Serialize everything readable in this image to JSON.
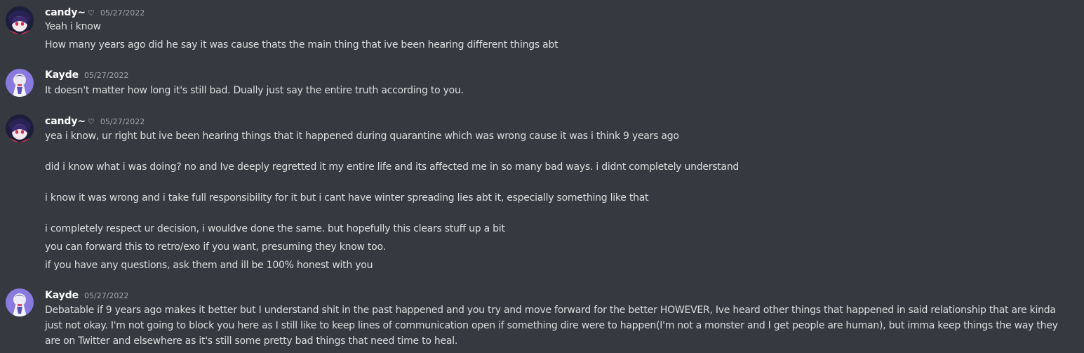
{
  "messages": [
    {
      "username": "candy~",
      "badge": "♡",
      "timestamp": "05/27/2022",
      "avatar": "candy-avatar-icon",
      "lines": [
        "Yeah i know",
        "How many years ago did he say it was cause thats the main thing that ive been hearing different things abt"
      ]
    },
    {
      "username": "Kayde",
      "timestamp": "05/27/2022",
      "avatar": "kayde-avatar-icon",
      "lines": [
        "It doesn't matter how long it's still bad. Dually just say the entire truth according to you."
      ]
    },
    {
      "username": "candy~",
      "badge": "♡",
      "timestamp": "05/27/2022",
      "avatar": "candy-avatar-icon",
      "lines": [
        "yea i know, ur right but ive been hearing things that it happened during quarantine which was wrong cause it was i think 9 years ago",
        "did i know what i was doing? no and Ive deeply regretted it my entire life and its affected me in so many bad ways. i didnt completely understand",
        "i know it was wrong and i take full responsibility for it but i cant have winter spreading lies abt it, especially something like that",
        "i completely respect ur decision, i wouldve done the same. but hopefully this clears stuff up a bit",
        "you can forward this to retro/exo if you want, presuming they know too.",
        "if you have any questions, ask them and ill be 100% honest with you"
      ]
    },
    {
      "username": "Kayde",
      "timestamp": "05/27/2022",
      "avatar": "kayde-avatar-icon",
      "lines": [
        "Debatable if 9 years ago makes it better but I understand shit in the past happened and you try and move forward for the better HOWEVER, Ive heard other things that happened in said relationship that are kinda just not okay. I'm not going to block you here as I still like to keep lines of communication open if something dire were to happen(I'm not a monster and I get people are human), but imma keep things the way they are on Twitter and elsewhere as it's still some pretty bad things that need time to heal."
      ]
    }
  ]
}
